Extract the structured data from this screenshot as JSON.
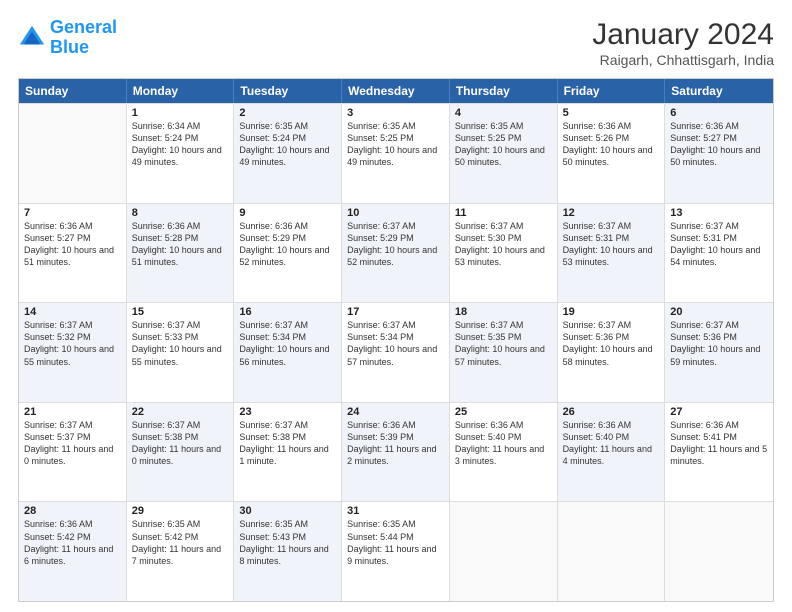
{
  "header": {
    "logo_line1": "General",
    "logo_line2": "Blue",
    "month_year": "January 2024",
    "location": "Raigarh, Chhattisgarh, India"
  },
  "days_of_week": [
    "Sunday",
    "Monday",
    "Tuesday",
    "Wednesday",
    "Thursday",
    "Friday",
    "Saturday"
  ],
  "weeks": [
    [
      {
        "day": "",
        "sunrise": "",
        "sunset": "",
        "daylight": "",
        "bg": "empty"
      },
      {
        "day": "1",
        "sunrise": "Sunrise: 6:34 AM",
        "sunset": "Sunset: 5:24 PM",
        "daylight": "Daylight: 10 hours and 49 minutes.",
        "bg": ""
      },
      {
        "day": "2",
        "sunrise": "Sunrise: 6:35 AM",
        "sunset": "Sunset: 5:24 PM",
        "daylight": "Daylight: 10 hours and 49 minutes.",
        "bg": "alt"
      },
      {
        "day": "3",
        "sunrise": "Sunrise: 6:35 AM",
        "sunset": "Sunset: 5:25 PM",
        "daylight": "Daylight: 10 hours and 49 minutes.",
        "bg": ""
      },
      {
        "day": "4",
        "sunrise": "Sunrise: 6:35 AM",
        "sunset": "Sunset: 5:25 PM",
        "daylight": "Daylight: 10 hours and 50 minutes.",
        "bg": "alt"
      },
      {
        "day": "5",
        "sunrise": "Sunrise: 6:36 AM",
        "sunset": "Sunset: 5:26 PM",
        "daylight": "Daylight: 10 hours and 50 minutes.",
        "bg": ""
      },
      {
        "day": "6",
        "sunrise": "Sunrise: 6:36 AM",
        "sunset": "Sunset: 5:27 PM",
        "daylight": "Daylight: 10 hours and 50 minutes.",
        "bg": "alt"
      }
    ],
    [
      {
        "day": "7",
        "sunrise": "Sunrise: 6:36 AM",
        "sunset": "Sunset: 5:27 PM",
        "daylight": "Daylight: 10 hours and 51 minutes.",
        "bg": ""
      },
      {
        "day": "8",
        "sunrise": "Sunrise: 6:36 AM",
        "sunset": "Sunset: 5:28 PM",
        "daylight": "Daylight: 10 hours and 51 minutes.",
        "bg": "alt"
      },
      {
        "day": "9",
        "sunrise": "Sunrise: 6:36 AM",
        "sunset": "Sunset: 5:29 PM",
        "daylight": "Daylight: 10 hours and 52 minutes.",
        "bg": ""
      },
      {
        "day": "10",
        "sunrise": "Sunrise: 6:37 AM",
        "sunset": "Sunset: 5:29 PM",
        "daylight": "Daylight: 10 hours and 52 minutes.",
        "bg": "alt"
      },
      {
        "day": "11",
        "sunrise": "Sunrise: 6:37 AM",
        "sunset": "Sunset: 5:30 PM",
        "daylight": "Daylight: 10 hours and 53 minutes.",
        "bg": ""
      },
      {
        "day": "12",
        "sunrise": "Sunrise: 6:37 AM",
        "sunset": "Sunset: 5:31 PM",
        "daylight": "Daylight: 10 hours and 53 minutes.",
        "bg": "alt"
      },
      {
        "day": "13",
        "sunrise": "Sunrise: 6:37 AM",
        "sunset": "Sunset: 5:31 PM",
        "daylight": "Daylight: 10 hours and 54 minutes.",
        "bg": ""
      }
    ],
    [
      {
        "day": "14",
        "sunrise": "Sunrise: 6:37 AM",
        "sunset": "Sunset: 5:32 PM",
        "daylight": "Daylight: 10 hours and 55 minutes.",
        "bg": "alt"
      },
      {
        "day": "15",
        "sunrise": "Sunrise: 6:37 AM",
        "sunset": "Sunset: 5:33 PM",
        "daylight": "Daylight: 10 hours and 55 minutes.",
        "bg": ""
      },
      {
        "day": "16",
        "sunrise": "Sunrise: 6:37 AM",
        "sunset": "Sunset: 5:34 PM",
        "daylight": "Daylight: 10 hours and 56 minutes.",
        "bg": "alt"
      },
      {
        "day": "17",
        "sunrise": "Sunrise: 6:37 AM",
        "sunset": "Sunset: 5:34 PM",
        "daylight": "Daylight: 10 hours and 57 minutes.",
        "bg": ""
      },
      {
        "day": "18",
        "sunrise": "Sunrise: 6:37 AM",
        "sunset": "Sunset: 5:35 PM",
        "daylight": "Daylight: 10 hours and 57 minutes.",
        "bg": "alt"
      },
      {
        "day": "19",
        "sunrise": "Sunrise: 6:37 AM",
        "sunset": "Sunset: 5:36 PM",
        "daylight": "Daylight: 10 hours and 58 minutes.",
        "bg": ""
      },
      {
        "day": "20",
        "sunrise": "Sunrise: 6:37 AM",
        "sunset": "Sunset: 5:36 PM",
        "daylight": "Daylight: 10 hours and 59 minutes.",
        "bg": "alt"
      }
    ],
    [
      {
        "day": "21",
        "sunrise": "Sunrise: 6:37 AM",
        "sunset": "Sunset: 5:37 PM",
        "daylight": "Daylight: 11 hours and 0 minutes.",
        "bg": ""
      },
      {
        "day": "22",
        "sunrise": "Sunrise: 6:37 AM",
        "sunset": "Sunset: 5:38 PM",
        "daylight": "Daylight: 11 hours and 0 minutes.",
        "bg": "alt"
      },
      {
        "day": "23",
        "sunrise": "Sunrise: 6:37 AM",
        "sunset": "Sunset: 5:38 PM",
        "daylight": "Daylight: 11 hours and 1 minute.",
        "bg": ""
      },
      {
        "day": "24",
        "sunrise": "Sunrise: 6:36 AM",
        "sunset": "Sunset: 5:39 PM",
        "daylight": "Daylight: 11 hours and 2 minutes.",
        "bg": "alt"
      },
      {
        "day": "25",
        "sunrise": "Sunrise: 6:36 AM",
        "sunset": "Sunset: 5:40 PM",
        "daylight": "Daylight: 11 hours and 3 minutes.",
        "bg": ""
      },
      {
        "day": "26",
        "sunrise": "Sunrise: 6:36 AM",
        "sunset": "Sunset: 5:40 PM",
        "daylight": "Daylight: 11 hours and 4 minutes.",
        "bg": "alt"
      },
      {
        "day": "27",
        "sunrise": "Sunrise: 6:36 AM",
        "sunset": "Sunset: 5:41 PM",
        "daylight": "Daylight: 11 hours and 5 minutes.",
        "bg": ""
      }
    ],
    [
      {
        "day": "28",
        "sunrise": "Sunrise: 6:36 AM",
        "sunset": "Sunset: 5:42 PM",
        "daylight": "Daylight: 11 hours and 6 minutes.",
        "bg": "alt"
      },
      {
        "day": "29",
        "sunrise": "Sunrise: 6:35 AM",
        "sunset": "Sunset: 5:42 PM",
        "daylight": "Daylight: 11 hours and 7 minutes.",
        "bg": ""
      },
      {
        "day": "30",
        "sunrise": "Sunrise: 6:35 AM",
        "sunset": "Sunset: 5:43 PM",
        "daylight": "Daylight: 11 hours and 8 minutes.",
        "bg": "alt"
      },
      {
        "day": "31",
        "sunrise": "Sunrise: 6:35 AM",
        "sunset": "Sunset: 5:44 PM",
        "daylight": "Daylight: 11 hours and 9 minutes.",
        "bg": ""
      },
      {
        "day": "",
        "sunrise": "",
        "sunset": "",
        "daylight": "",
        "bg": "empty"
      },
      {
        "day": "",
        "sunrise": "",
        "sunset": "",
        "daylight": "",
        "bg": "empty"
      },
      {
        "day": "",
        "sunrise": "",
        "sunset": "",
        "daylight": "",
        "bg": "empty"
      }
    ]
  ]
}
